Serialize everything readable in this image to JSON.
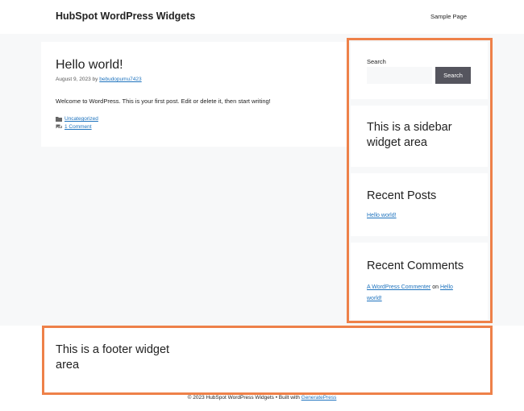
{
  "header": {
    "site_title": "HubSpot WordPress Widgets",
    "nav": [
      "Sample Page"
    ]
  },
  "post": {
    "title": "Hello world!",
    "date": "August 9, 2023",
    "by": "by",
    "author": "bebudopumu7423",
    "body": "Welcome to WordPress. This is your first post. Edit or delete it, then start writing!",
    "category": "Uncategorized",
    "comments": "1 Comment"
  },
  "sidebar": {
    "search_label": "Search",
    "search_value": "",
    "search_button": "Search",
    "area_heading_line1": "This is a sidebar",
    "area_heading_line2": "widget area",
    "recent_posts_heading": "Recent Posts",
    "recent_post": "Hello world!",
    "recent_comments_heading": "Recent Comments",
    "comment_author": "A WordPress Commenter",
    "comment_on": "on",
    "comment_post_line1": "Hello",
    "comment_post_line2": "world!"
  },
  "footer": {
    "heading_line1": "This is a footer widget",
    "heading_line2": "area",
    "copyright": "© 2023 HubSpot WordPress Widgets • Built with",
    "built_with": "GeneratePress"
  },
  "colors": {
    "highlight": "#ee8149",
    "link": "#1e73be",
    "button": "#55555e",
    "background": "#f7f8f9"
  }
}
